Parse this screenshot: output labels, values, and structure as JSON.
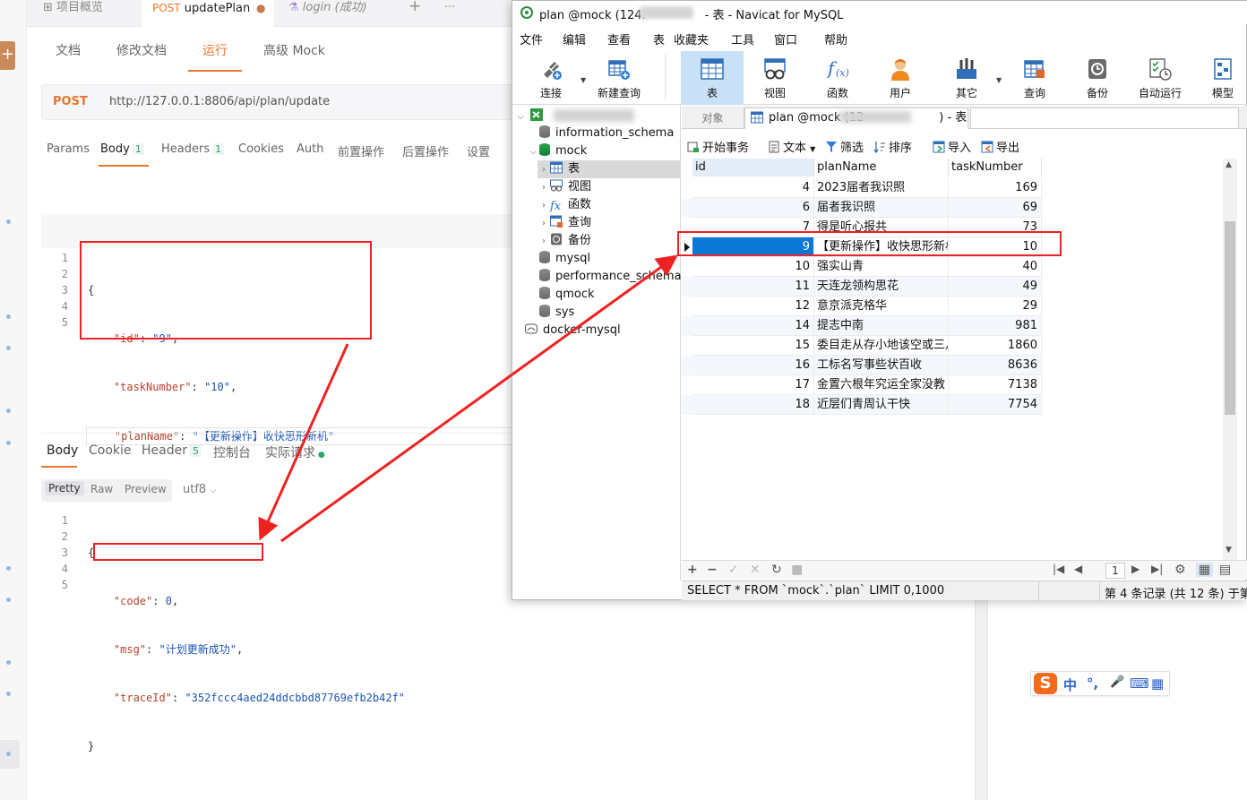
{
  "apifox": {
    "top_tabs": [
      {
        "label": "项目概览"
      },
      {
        "method": "POST",
        "label": "updatePlan"
      },
      {
        "label": "login (成功)"
      }
    ],
    "top_tab_plus": "+",
    "top_tab_more": "···",
    "plus_button": "+",
    "sub_tabs": [
      "文档",
      "修改文档",
      "运行",
      "高级 Mock"
    ],
    "url": {
      "method": "POST",
      "value": "http://127.0.0.1:8806/api/plan/update"
    },
    "request_tabs": [
      {
        "label": "Params"
      },
      {
        "label": "Body",
        "badge": "1"
      },
      {
        "label": "Headers",
        "badge": "1"
      },
      {
        "label": "Cookies"
      },
      {
        "label": "Auth"
      },
      {
        "label": "前置操作"
      },
      {
        "label": "后置操作"
      },
      {
        "label": "设置"
      }
    ],
    "request_body": {
      "line_numbers": [
        "1",
        "2",
        "3",
        "4",
        "5"
      ],
      "open": "{",
      "close": "}",
      "fields": [
        {
          "key": "\"id\"",
          "value": "\"9\"",
          "sep": ","
        },
        {
          "key": "\"taskNumber\"",
          "value": "\"10\"",
          "sep": ","
        },
        {
          "key": "\"planName\"",
          "value": "\"【更新操作】收快思形新机\"",
          "sep": ""
        }
      ]
    },
    "response_tabs": [
      {
        "label": "Body"
      },
      {
        "label": "Cookie"
      },
      {
        "label": "Header",
        "badge": "5"
      },
      {
        "label": "控制台"
      },
      {
        "label": "实际请求"
      }
    ],
    "format_buttons": [
      "Pretty",
      "Raw",
      "Preview"
    ],
    "encoding": "utf8",
    "response_body": {
      "line_numbers": [
        "1",
        "2",
        "3",
        "4",
        "5"
      ],
      "open": "{",
      "close": "}",
      "fields": [
        {
          "key": "\"code\"",
          "value": "0",
          "sep": ","
        },
        {
          "key": "\"msg\"",
          "value": "\"计划更新成功\"",
          "sep": ","
        },
        {
          "key": "\"traceId\"",
          "value": "\"352fccc4aed24ddcbbd87769efb2b42f\"",
          "sep": ""
        }
      ]
    },
    "accent_color": "#e8772e"
  },
  "navicat": {
    "title_prefix": "plan @mock (124.",
    "title_suffix": "- 表 - Navicat for MySQL",
    "menu": [
      "文件",
      "编辑",
      "查看",
      "表",
      "收藏夹",
      "工具",
      "窗口",
      "帮助"
    ],
    "toolbar": [
      {
        "label": "连接",
        "icon": "connection-icon"
      },
      {
        "label": "新建查询",
        "icon": "new-query-icon"
      },
      {
        "label": "表",
        "icon": "table-icon"
      },
      {
        "label": "视图",
        "icon": "view-icon"
      },
      {
        "label": "函数",
        "icon": "function-icon"
      },
      {
        "label": "用户",
        "icon": "user-icon"
      },
      {
        "label": "其它",
        "icon": "others-icon"
      },
      {
        "label": "查询",
        "icon": "query-icon"
      },
      {
        "label": "备份",
        "icon": "backup-icon"
      },
      {
        "label": "自动运行",
        "icon": "auto-run-icon"
      },
      {
        "label": "模型",
        "icon": "model-icon"
      }
    ],
    "tree": {
      "schemas": [
        "information_schema",
        "mock"
      ],
      "mock_children": [
        "表",
        "视图",
        "函数",
        "查询",
        "备份"
      ],
      "other_dbs": [
        "mysql",
        "performance_schema",
        "qmock",
        "sys"
      ],
      "second_connection": "docker-mysql"
    },
    "tabs": {
      "object": "对象",
      "table_prefix": "plan @mock (12",
      "table_suffix": ") - 表"
    },
    "actions": [
      "开始事务",
      "文本",
      "筛选",
      "排序",
      "导入",
      "导出"
    ],
    "columns": [
      "id",
      "planName",
      "taskNumber"
    ],
    "rows": [
      {
        "id": "4",
        "planName": "2023届者我识照",
        "taskNumber": "169"
      },
      {
        "id": "6",
        "planName": "届者我识照",
        "taskNumber": "69"
      },
      {
        "id": "7",
        "planName": "得是听心报共",
        "taskNumber": "73"
      },
      {
        "id": "9",
        "planName": "【更新操作】收快思形新机",
        "taskNumber": "10",
        "selected": true
      },
      {
        "id": "10",
        "planName": "强实山青",
        "taskNumber": "40"
      },
      {
        "id": "11",
        "planName": "天连龙领构思花",
        "taskNumber": "49"
      },
      {
        "id": "12",
        "planName": "意京派克格华",
        "taskNumber": "29"
      },
      {
        "id": "14",
        "planName": "提志中南",
        "taskNumber": "981"
      },
      {
        "id": "15",
        "planName": "委目走从存小地该空或三八厂",
        "taskNumber": "1860"
      },
      {
        "id": "16",
        "planName": "工标名写事些状百收",
        "taskNumber": "8636"
      },
      {
        "id": "17",
        "planName": "金置六根年究运全家没教",
        "taskNumber": "7138"
      },
      {
        "id": "18",
        "planName": "近层们青周认干快",
        "taskNumber": "7754"
      }
    ],
    "page": "1",
    "sql": "SELECT * FROM `mock`.`plan` LIMIT 0,1000",
    "record_status": "第 4 条记录 (共 12 条) 于第",
    "selected_color": "#0b78d7"
  },
  "ime": {
    "logo": "S",
    "items": [
      "中",
      "°,",
      "🎤",
      "⌨",
      "▦"
    ]
  }
}
